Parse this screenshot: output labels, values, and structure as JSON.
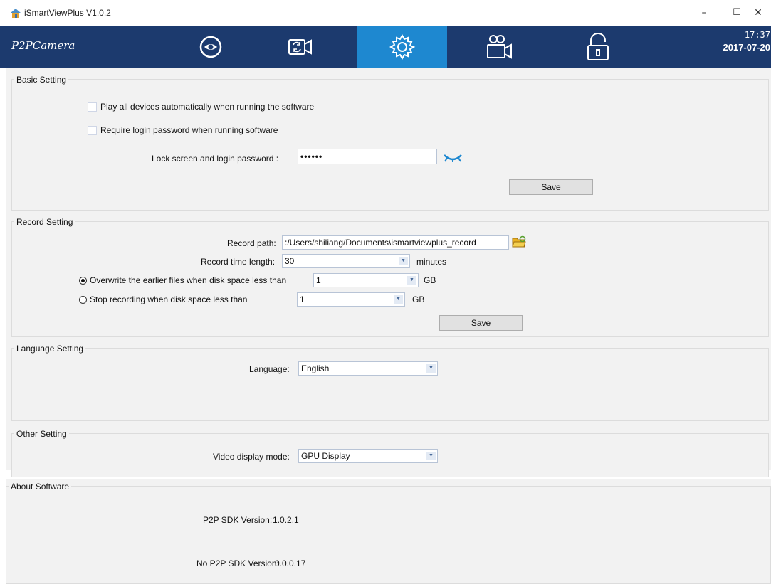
{
  "window": {
    "title": "iSmartViewPlus  V1.0.2",
    "minimize": "–",
    "maximize": "☐",
    "close": "✕"
  },
  "nav": {
    "logo": "P2PCamera",
    "tabs": [
      {
        "name": "preview",
        "icon": "eye-icon"
      },
      {
        "name": "playback",
        "icon": "camera-playback-icon"
      },
      {
        "name": "settings",
        "icon": "gear-icon"
      },
      {
        "name": "devices",
        "icon": "camera-add-icon"
      },
      {
        "name": "lock",
        "icon": "lock-icon"
      }
    ],
    "active_tab": "settings",
    "time": "17:37",
    "date": "2017-07-20"
  },
  "basic": {
    "title": "Basic Setting",
    "autoplay_label": "Play all devices automatically when running the software",
    "autoplay_checked": false,
    "require_password_label": "Require login password when running software",
    "require_password_checked": false,
    "lock_password_label": "Lock screen and login password :",
    "lock_password_value": "••••••",
    "save_label": "Save"
  },
  "record": {
    "title": "Record Setting",
    "path_label": "Record path:",
    "path_value": ":/Users/shiliang/Documents\\ismartviewplus_record",
    "time_label": "Record time length:",
    "time_value": "30",
    "time_unit": "minutes",
    "overwrite_label": "Overwrite the earlier files when disk space less than",
    "overwrite_value": "1",
    "overwrite_unit": "GB",
    "stop_label": "Stop recording when disk space less than",
    "stop_value": "1",
    "stop_unit": "GB",
    "selected_option": "overwrite",
    "save_label": "Save"
  },
  "language": {
    "title": "Language Setting",
    "label": "Language:",
    "value": "English"
  },
  "other": {
    "title": "Other Setting",
    "label": "Video display mode:",
    "value": "GPU Display"
  },
  "about": {
    "title": "About Software",
    "p2p_label": "P2P SDK Version:",
    "p2p_value": "1.0.2.1",
    "nop2p_label": "No P2P SDK Version:",
    "nop2p_value": "0.0.0.17"
  },
  "colors": {
    "nav_bg": "#1c3a6e",
    "nav_active": "#1e88d0",
    "panel_bg": "#f2f2f2",
    "eye_icon": "#1e88d0"
  }
}
